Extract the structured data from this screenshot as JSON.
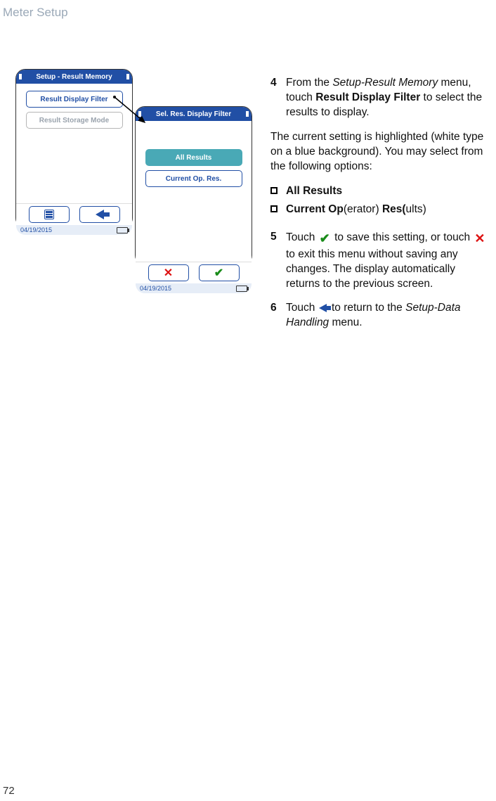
{
  "header": {
    "title": "Meter Setup"
  },
  "page_number": "72",
  "device_front": {
    "title": "Setup - Result Memory",
    "items": [
      {
        "label": "Result Display Filter",
        "style": "white"
      },
      {
        "label": "Result Storage Mode",
        "style": "gray"
      }
    ],
    "date": "04/19/2015"
  },
  "device_back": {
    "title": "Sel. Res. Display Filter",
    "items": [
      {
        "label": "All Results",
        "style": "selected"
      },
      {
        "label": "Current Op. Res.",
        "style": "white"
      }
    ],
    "date": "04/19/2015"
  },
  "steps": {
    "s4": {
      "num": "4",
      "pre": "From the ",
      "i1": "Setup-Result Memory",
      "mid": " menu, touch ",
      "b1": "Result Display Filter",
      "post": " to select the results to display."
    },
    "options_intro": "The current setting is highlighted (white type on a blue background). You may select from the following options:",
    "bullets": {
      "b1": "All Results",
      "b2a": "Current Op",
      "b2b": "(erator) ",
      "b2c": "Res(",
      "b2d": "ults)"
    },
    "s5": {
      "num": "5",
      "a": "Touch ",
      "b": " to save this setting, or touch ",
      "c": " to exit this menu without saving any changes. The display automatically returns to the previous screen."
    },
    "s6": {
      "num": "6",
      "a": "Touch ",
      "b": " to return to the ",
      "i1": "Setup-Data Handling",
      "c": " menu."
    }
  }
}
